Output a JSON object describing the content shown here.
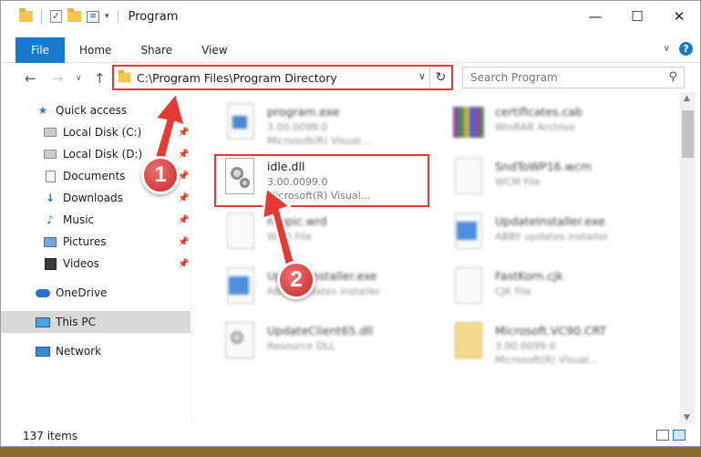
{
  "window": {
    "title": "Program",
    "controls": {
      "minimize": "—",
      "maximize": "☐",
      "close": "✕"
    }
  },
  "ribbon": {
    "tabs": [
      {
        "label": "File"
      },
      {
        "label": "Home"
      },
      {
        "label": "Share"
      },
      {
        "label": "View"
      }
    ]
  },
  "address": {
    "path": "C:\\Program Files\\Program Directory",
    "search_placeholder": "Search Program"
  },
  "nav": {
    "items": [
      {
        "label": "Quick access"
      },
      {
        "label": "Local Disk (C:)"
      },
      {
        "label": "Local Disk (D:)"
      },
      {
        "label": "Documents"
      },
      {
        "label": "Downloads"
      },
      {
        "label": "Music"
      },
      {
        "label": "Pictures"
      },
      {
        "label": "Videos"
      },
      {
        "label": "OneDrive"
      },
      {
        "label": "This PC"
      },
      {
        "label": "Network"
      }
    ]
  },
  "files": [
    {
      "name": "program.exe",
      "line1": "3.00.0099.0",
      "line2": "Microsoft(R) Visual..."
    },
    {
      "name": "certificates.cab",
      "line1": "WinRAR Archive",
      "line2": ""
    },
    {
      "name": "idle.dll",
      "line1": "3.00.0099.0",
      "line2": "Microsoft(R) Visual..."
    },
    {
      "name": "SndToWP16.wcm",
      "line1": "WCM File",
      "line2": ""
    },
    {
      "name": "ntopic.wrd",
      "line1": "WRD File",
      "line2": ""
    },
    {
      "name": "UpdateInstaller.exe",
      "line1": "ABBY updates installer",
      "line2": ""
    },
    {
      "name": "UpdateInstaller.exe",
      "line1": "ABBY updates installer",
      "line2": ""
    },
    {
      "name": "FastKorn.cjk",
      "line1": "CJK File",
      "line2": ""
    },
    {
      "name": "UpdateClient65.dll",
      "line1": "Resource DLL",
      "line2": ""
    },
    {
      "name": "Microsoft.VC90.CRT",
      "line1": "3.00.0099.0",
      "line2": "Microsoft(R) Visual..."
    }
  ],
  "status": {
    "count": "137 items"
  },
  "annotations": {
    "step1": "1",
    "step2": "2"
  },
  "colors": {
    "accent": "#1979ca",
    "highlight": "#e03a3a"
  }
}
